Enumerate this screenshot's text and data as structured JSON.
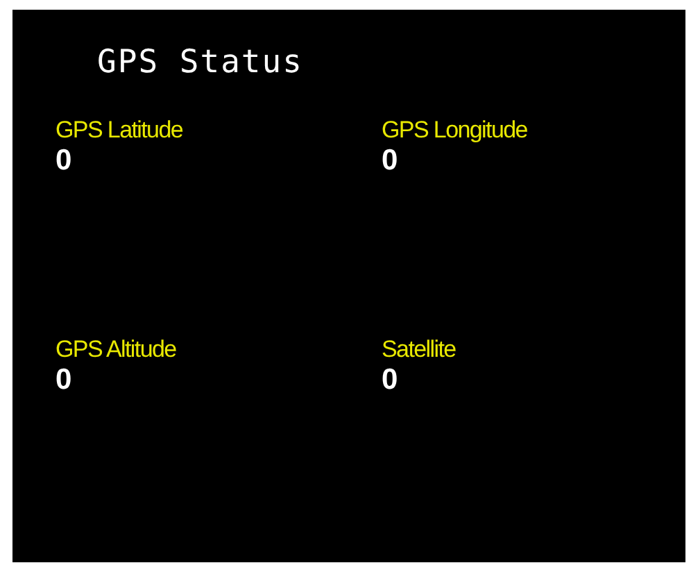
{
  "title": "GPS Status",
  "fields": [
    {
      "label": "GPS Latitude",
      "value": "0"
    },
    {
      "label": "GPS Longitude",
      "value": "0"
    },
    {
      "label": "GPS Altitude",
      "value": "0"
    },
    {
      "label": "Satellite",
      "value": "0"
    }
  ]
}
